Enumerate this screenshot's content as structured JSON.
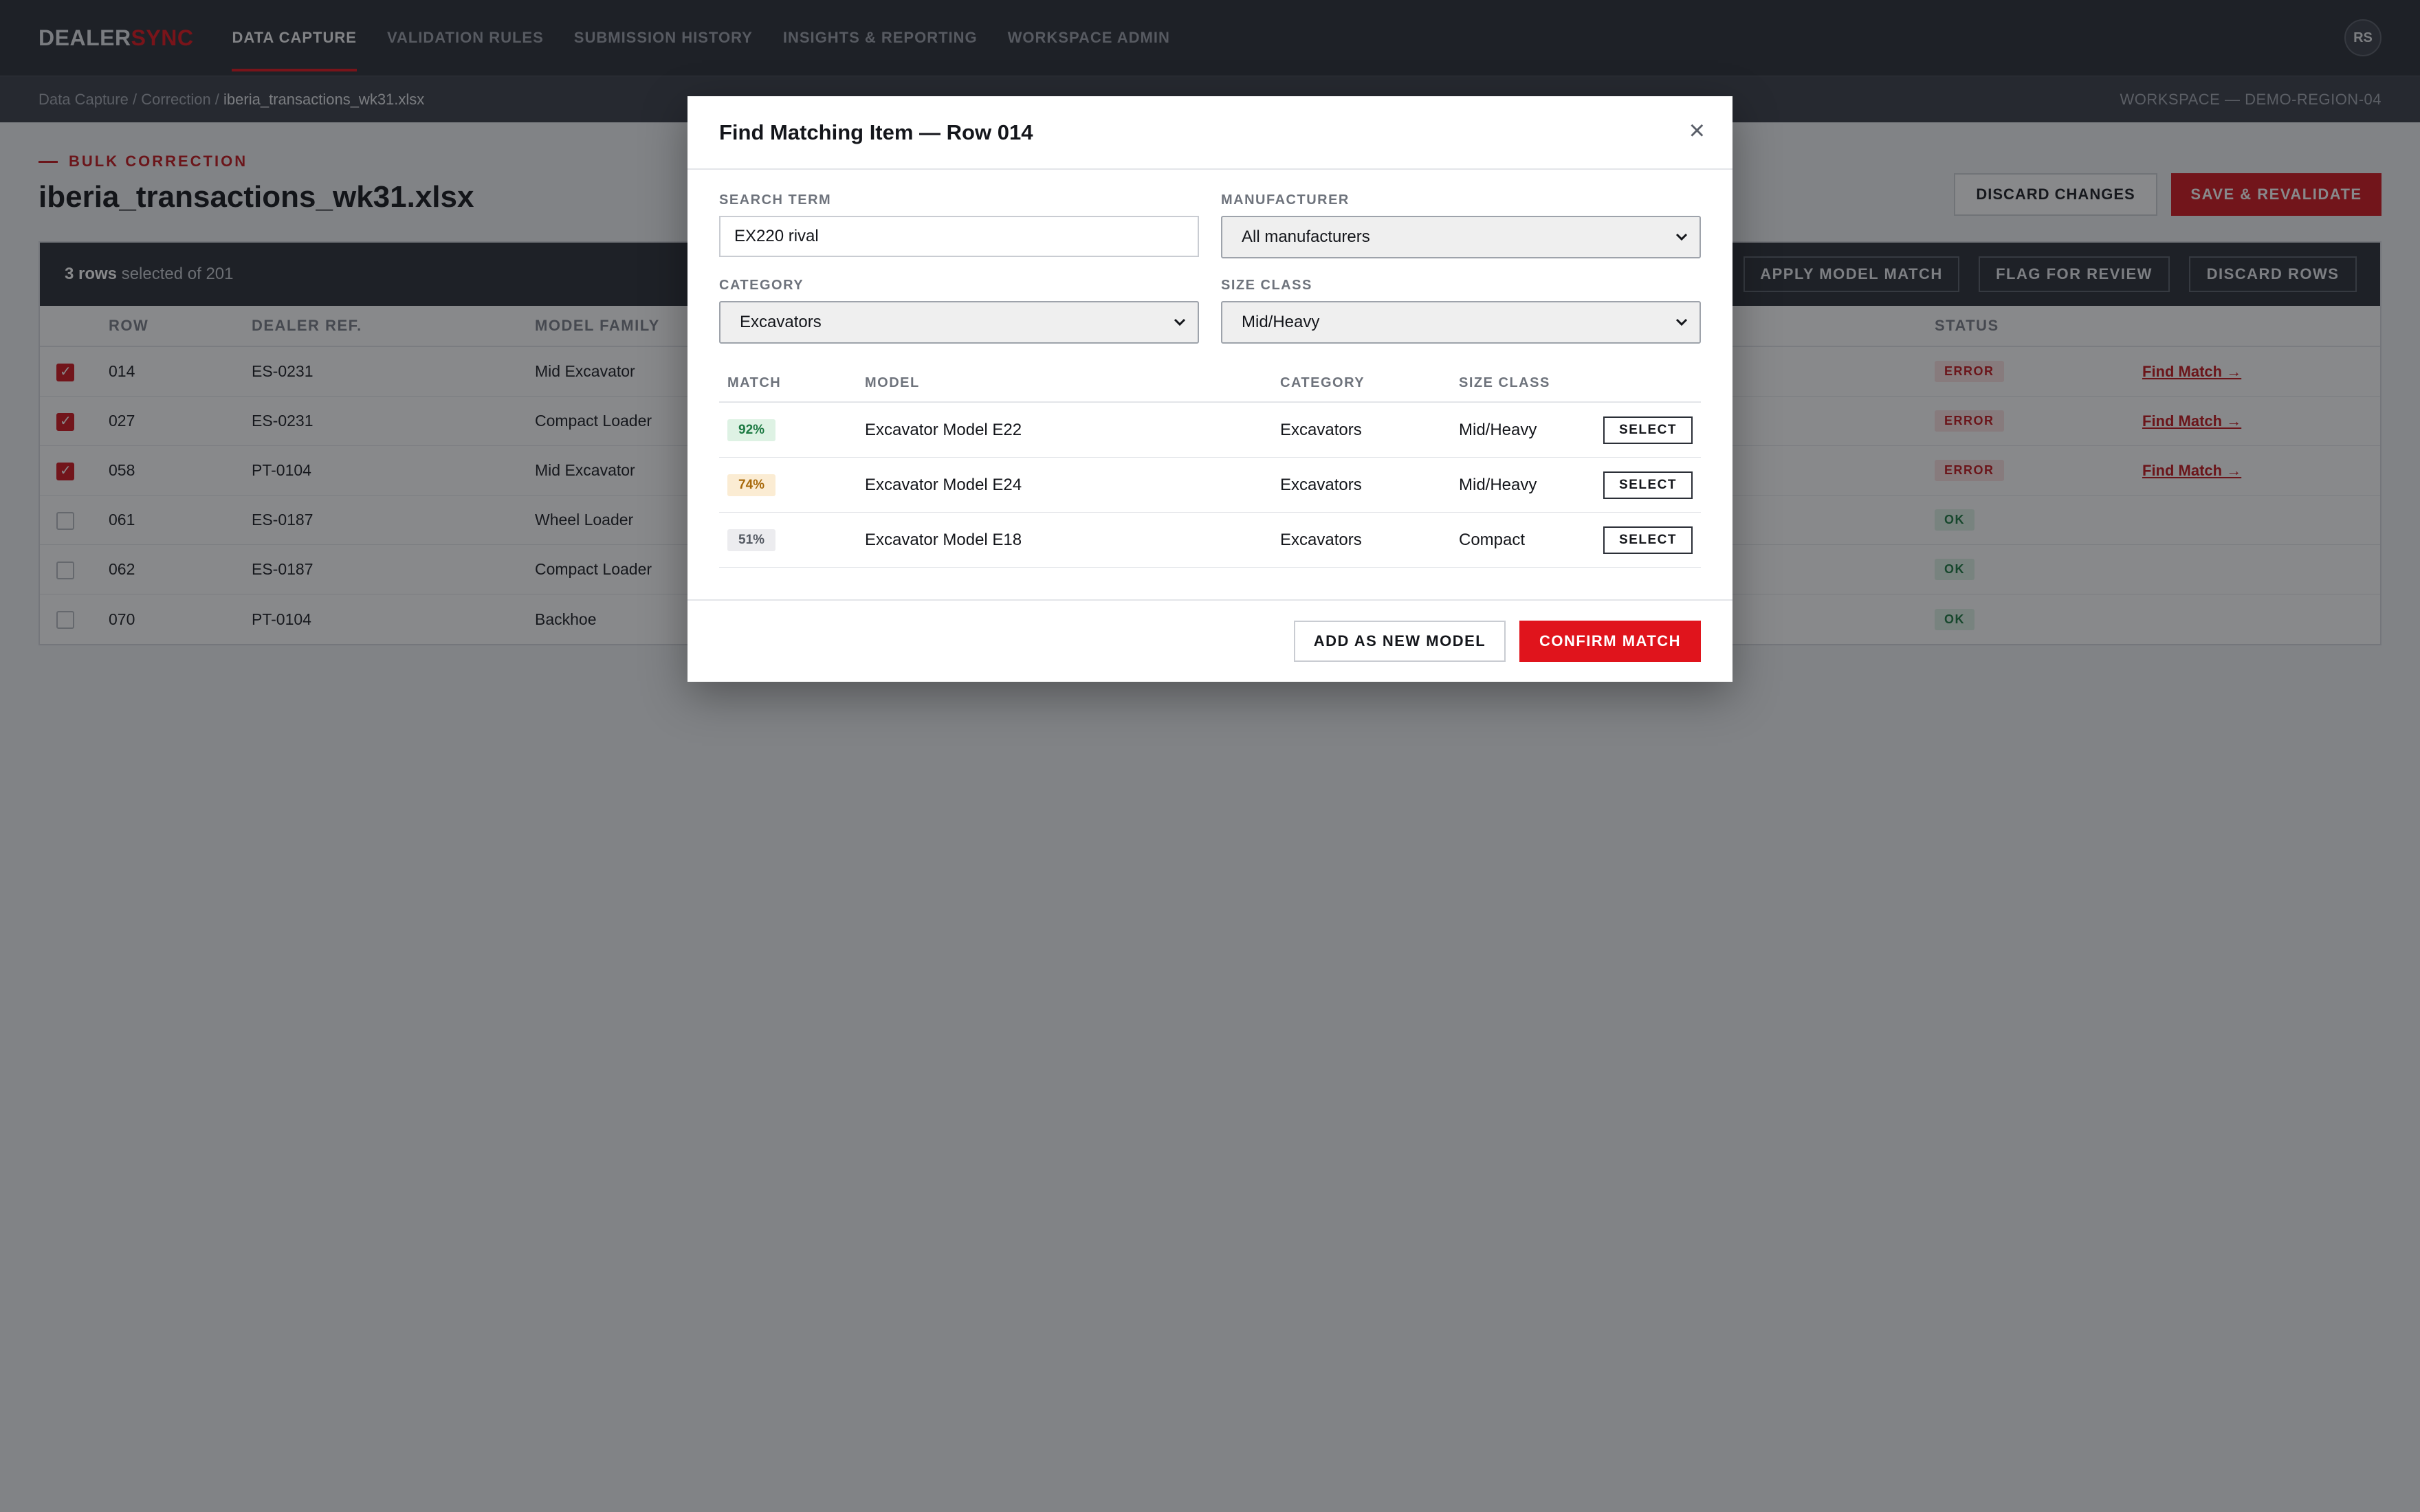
{
  "app": {
    "logo_main": "DEALER",
    "logo_accent": "SYNC"
  },
  "nav": [
    {
      "label": "DATA CAPTURE",
      "active": true
    },
    {
      "label": "VALIDATION RULES"
    },
    {
      "label": "SUBMISSION HISTORY"
    },
    {
      "label": "INSIGHTS & REPORTING"
    },
    {
      "label": "WORKSPACE ADMIN"
    }
  ],
  "user": {
    "initials": "RS"
  },
  "breadcrumb": {
    "crumb1": "Data Capture",
    "sep": " / ",
    "crumb2": "Correction",
    "current": "iberia_transactions_wk31.xlsx"
  },
  "workspace": "WORKSPACE — DEMO-REGION-04",
  "header": {
    "eyebrow": "BULK CORRECTION",
    "title": "iberia_transactions_wk31.xlsx",
    "discard_label": "DISCARD CHANGES",
    "save_label": "SAVE & REVALIDATE"
  },
  "selection": {
    "count": "3 rows",
    "rest": " selected of 201",
    "apply_label": "APPLY MODEL MATCH",
    "flag_label": "FLAG FOR REVIEW",
    "discard_rows_label": "DISCARD ROWS"
  },
  "table": {
    "columns": {
      "row": "ROW",
      "dealer": "DEALER REF.",
      "model": "MODEL FAMILY",
      "status": "STATUS"
    },
    "rows": [
      {
        "row": "014",
        "dealer": "ES-0231",
        "model": "Mid Excavator",
        "status": "ERROR",
        "action": "Find Match →",
        "checked": true
      },
      {
        "row": "027",
        "dealer": "ES-0231",
        "model": "Compact Loader",
        "status": "ERROR",
        "action": "Find Match →",
        "checked": true
      },
      {
        "row": "058",
        "dealer": "PT-0104",
        "model": "Mid Excavator",
        "status": "ERROR",
        "action": "Find Match →",
        "checked": true
      },
      {
        "row": "061",
        "dealer": "ES-0187",
        "model": "Wheel Loader",
        "status": "OK",
        "checked": false
      },
      {
        "row": "062",
        "dealer": "ES-0187",
        "model": "Compact Loader",
        "status": "OK",
        "checked": false
      },
      {
        "row": "070",
        "dealer": "PT-0104",
        "model": "Backhoe",
        "status": "OK",
        "checked": false
      }
    ]
  },
  "modal": {
    "title": "Find Matching Item — Row 014",
    "close_glyph": "×",
    "search_label": "SEARCH TERM",
    "search_value": "EX220 rival",
    "manufacturer_label": "MANUFACTURER",
    "manufacturer_value": "All manufacturers",
    "category_label": "CATEGORY",
    "category_value": "Excavators",
    "size_label": "SIZE CLASS",
    "size_value": "Mid/Heavy",
    "columns": {
      "match": "MATCH",
      "model": "MODEL",
      "category": "CATEGORY",
      "size": "SIZE CLASS"
    },
    "results": [
      {
        "match": "92%",
        "model": "Excavator Model E22",
        "category": "Excavators",
        "size": "Mid/Heavy",
        "select": "SELECT"
      },
      {
        "match": "74%",
        "model": "Excavator Model E24",
        "category": "Excavators",
        "size": "Mid/Heavy",
        "select": "SELECT"
      },
      {
        "match": "51%",
        "model": "Excavator Model E18",
        "category": "Excavators",
        "size": "Compact",
        "select": "SELECT"
      }
    ],
    "add_new_label": "ADD AS NEW MODEL",
    "confirm_label": "CONFIRM MATCH"
  },
  "colors": {
    "accent": "#e0141c",
    "nav_bg": "#2b2f37",
    "error": "#c4161c",
    "ok": "#1d7a43"
  }
}
